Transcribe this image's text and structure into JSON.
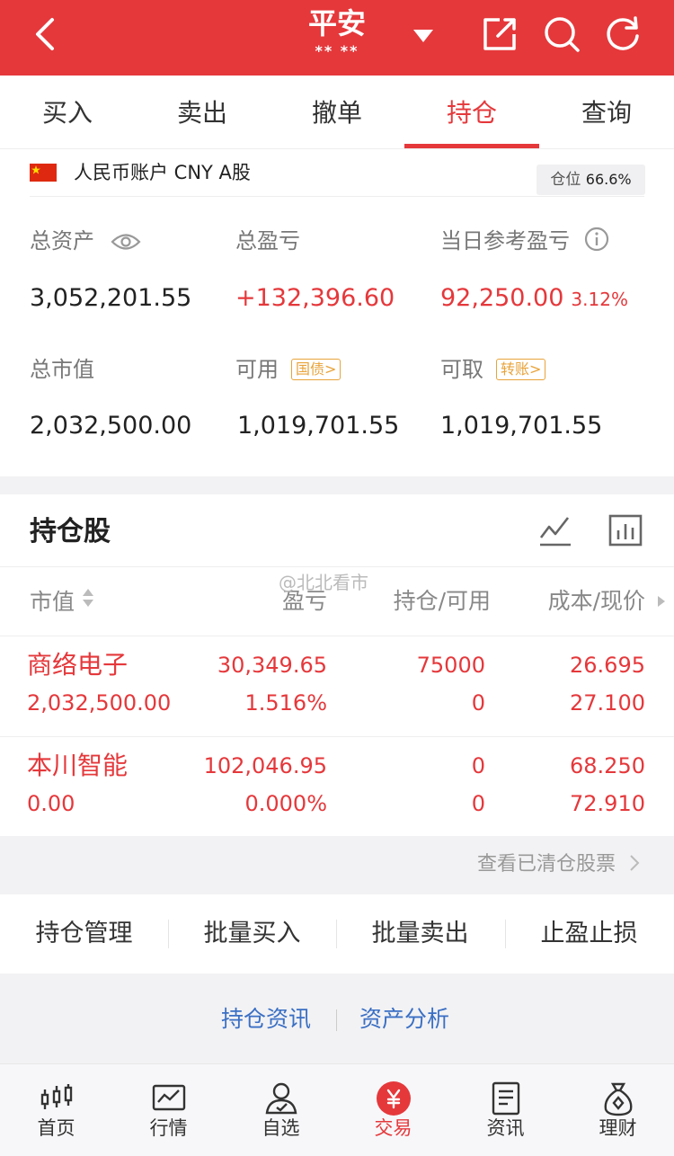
{
  "header": {
    "title": "平安",
    "subtitle": "** **",
    "icons": [
      "back-icon",
      "chevron-down-icon",
      "share-icon",
      "search-icon",
      "refresh-icon"
    ]
  },
  "tabs": [
    {
      "label": "买入",
      "active": false
    },
    {
      "label": "卖出",
      "active": false
    },
    {
      "label": "撤单",
      "active": false
    },
    {
      "label": "持仓",
      "active": true
    },
    {
      "label": "查询",
      "active": false
    }
  ],
  "account": {
    "label": "人民币账户 CNY A股",
    "position_label": "仓位",
    "position_value": "66.6%",
    "total_assets_label": "总资产",
    "total_assets": "3,052,201.55",
    "total_pl_label": "总盈亏",
    "total_pl": "+132,396.60",
    "daily_pl_label": "当日参考盈亏",
    "daily_pl": "92,250.00",
    "daily_pl_pct": "3.12%",
    "market_value_label": "总市值",
    "market_value": "2,032,500.00",
    "available_label": "可用",
    "available_tag": "国债>",
    "available": "1,019,701.55",
    "withdrawable_label": "可取",
    "withdrawable_tag": "转账>",
    "withdrawable": "1,019,701.55"
  },
  "holdings": {
    "title": "持仓股",
    "watermark": "@北北看市",
    "columns": [
      "市值",
      "盈亏",
      "持仓/可用",
      "成本/现价"
    ],
    "rows": [
      {
        "name": "商络电子",
        "market_value": "2,032,500.00",
        "pl": "30,349.65",
        "pl_pct": "1.516%",
        "position": "75000",
        "available": "0",
        "cost": "26.695",
        "price": "27.100"
      },
      {
        "name": "本川智能",
        "market_value": "0.00",
        "pl": "102,046.95",
        "pl_pct": "0.000%",
        "position": "0",
        "available": "0",
        "cost": "68.250",
        "price": "72.910"
      }
    ],
    "cleared_link": "查看已清仓股票"
  },
  "actions": [
    "持仓管理",
    "批量买入",
    "批量卖出",
    "止盈止损"
  ],
  "links": [
    "持仓资讯",
    "资产分析"
  ],
  "nav": [
    {
      "label": "首页",
      "icon": "home-candlestick-icon",
      "active": false
    },
    {
      "label": "行情",
      "icon": "market-chart-icon",
      "active": false
    },
    {
      "label": "自选",
      "icon": "watchlist-user-icon",
      "active": false
    },
    {
      "label": "交易",
      "icon": "trade-yen-icon",
      "active": true
    },
    {
      "label": "资讯",
      "icon": "news-document-icon",
      "active": false
    },
    {
      "label": "理财",
      "icon": "money-bag-icon",
      "active": false
    }
  ],
  "colors": {
    "brand_red": "#e5383b",
    "tag_orange": "#e8a33a",
    "link_blue": "#3a6fc4"
  }
}
